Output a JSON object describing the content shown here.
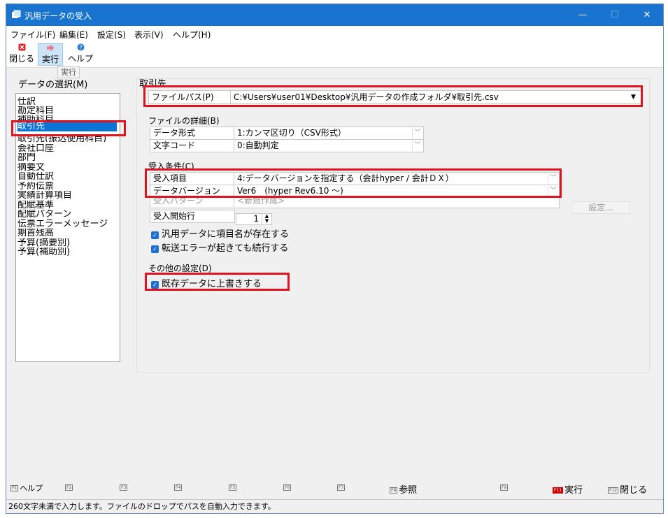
{
  "window": {
    "title": "汎用データの受入",
    "controls": {
      "minimize": "—",
      "maximize": "☐",
      "close": "✕"
    }
  },
  "menubar": [
    "ファイル(F)",
    "編集(E)",
    "設定(S)",
    "表示(V)",
    "ヘルプ(H)"
  ],
  "toolbar": {
    "close_label": "閉じる",
    "run_label": "実行",
    "help_label": "ヘルプ",
    "tooltip": "実行",
    "colors": {
      "close_icon": "#e02020",
      "run_icon": "#e87a90",
      "help_icon": "#2f7fd6"
    }
  },
  "left": {
    "title": "データの選択(M)",
    "items": [
      "仕訳",
      "勘定科目",
      "補助科目",
      "取引先",
      "取引先(振込使用科目)",
      "会社口座",
      "部門",
      "摘要文",
      "自動仕訳",
      "予約伝票",
      "実績計算項目",
      "配賦基準",
      "配賦パターン",
      "伝票エラーメッセージ",
      "期首残高",
      "予算(摘要別)",
      "予算(補助別)"
    ],
    "selected_index": 3
  },
  "main": {
    "section_title": "取引先",
    "file_path_label": "ファイルパス(P)",
    "file_path_value": "C:¥Users¥user01¥Desktop¥汎用データの作成フォルダ¥取引先.csv",
    "file_detail_title": "ファイルの詳細(B)",
    "data_format_label": "データ形式",
    "data_format_value": "1:カンマ区切り（CSV形式）",
    "char_code_label": "文字コード",
    "char_code_value": "0:自動判定",
    "import_cond_title": "受入条件(C)",
    "import_item_label": "受入項目",
    "import_item_value": "4:データバージョンを指定する（会計hyper / 会計ＤＸ）",
    "data_version_label": "データバージョン",
    "data_version_value": "Ver6　(hyper Rev6.10 ～)",
    "import_pattern_label": "受入パターン",
    "import_pattern_value": "<新規作成>",
    "setting_button": "設定...",
    "start_row_label": "受入開始行",
    "start_row_value": "1",
    "check_header_label": "汎用データに項目名が存在する",
    "check_continue_label": "転送エラーが起きても続行する",
    "other_title": "その他の設定(D)",
    "check_overwrite_label": "既存データに上書きする"
  },
  "fkeys": {
    "f1_tag": "F1",
    "f1_label": "ヘルプ",
    "f2": "F2",
    "f3": "F3",
    "f4": "F4",
    "f5": "F5",
    "f6": "F6",
    "f7": "F7",
    "f8_tag": "F8",
    "f8_label": "参照",
    "f9": "F9",
    "f11_tag": "F11",
    "f11_label": "実行",
    "f12_tag": "F12",
    "f12_label": "閉じる"
  },
  "status_text": "260文字未満で入力します。ファイルのドロップでパスを自動入力できます。",
  "accent_colors": {
    "titlebar": "#1874cf",
    "selection": "#0b74d6",
    "highlight_box": "#e0141e",
    "checkbox": "#1f6fd0"
  }
}
